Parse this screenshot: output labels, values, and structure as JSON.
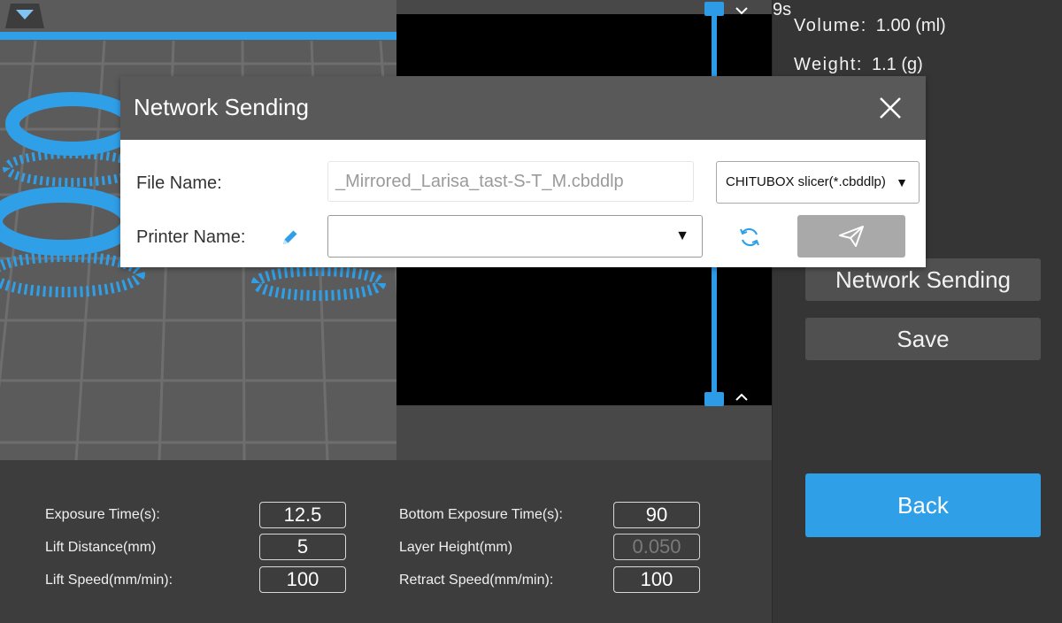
{
  "right_panel": {
    "volume_label": "Volume:",
    "volume_value": "1.00  (ml)",
    "weight_label": "Weight:",
    "weight_value": "1.1  (g)",
    "time_partial": "9s",
    "network_sending_label": "Network Sending",
    "save_label": "Save",
    "back_label": "Back",
    "accent_color": "#2f9fe8"
  },
  "settings": {
    "exposure_time_label": "Exposure Time(s):",
    "exposure_time_value": "12.5",
    "lift_distance_label": "Lift Distance(mm)",
    "lift_distance_value": "5",
    "lift_speed_label": "Lift Speed(mm/min):",
    "lift_speed_value": "100",
    "bottom_exposure_label": "Bottom Exposure Time(s):",
    "bottom_exposure_value": "90",
    "layer_height_label": "Layer Height(mm)",
    "layer_height_value": "0.050",
    "retract_speed_label": "Retract Speed(mm/min):",
    "retract_speed_value": "100"
  },
  "dialog": {
    "title": "Network Sending",
    "file_name_label": "File Name:",
    "file_name_value": "_Mirrored_Larisa_tast-S-T_M.cbddlp",
    "format_selected": "CHITUBOX slicer(*.cbddlp)",
    "printer_name_label": "Printer Name:",
    "printer_name_value": ""
  },
  "icons": {
    "close": "close-icon",
    "edit": "pencil-icon",
    "refresh": "refresh-icon",
    "send": "paper-plane-icon",
    "viewport_toggle": "triangle-down-icon",
    "slider_up": "chevron-up-icon",
    "slider_down": "chevron-down-icon"
  }
}
